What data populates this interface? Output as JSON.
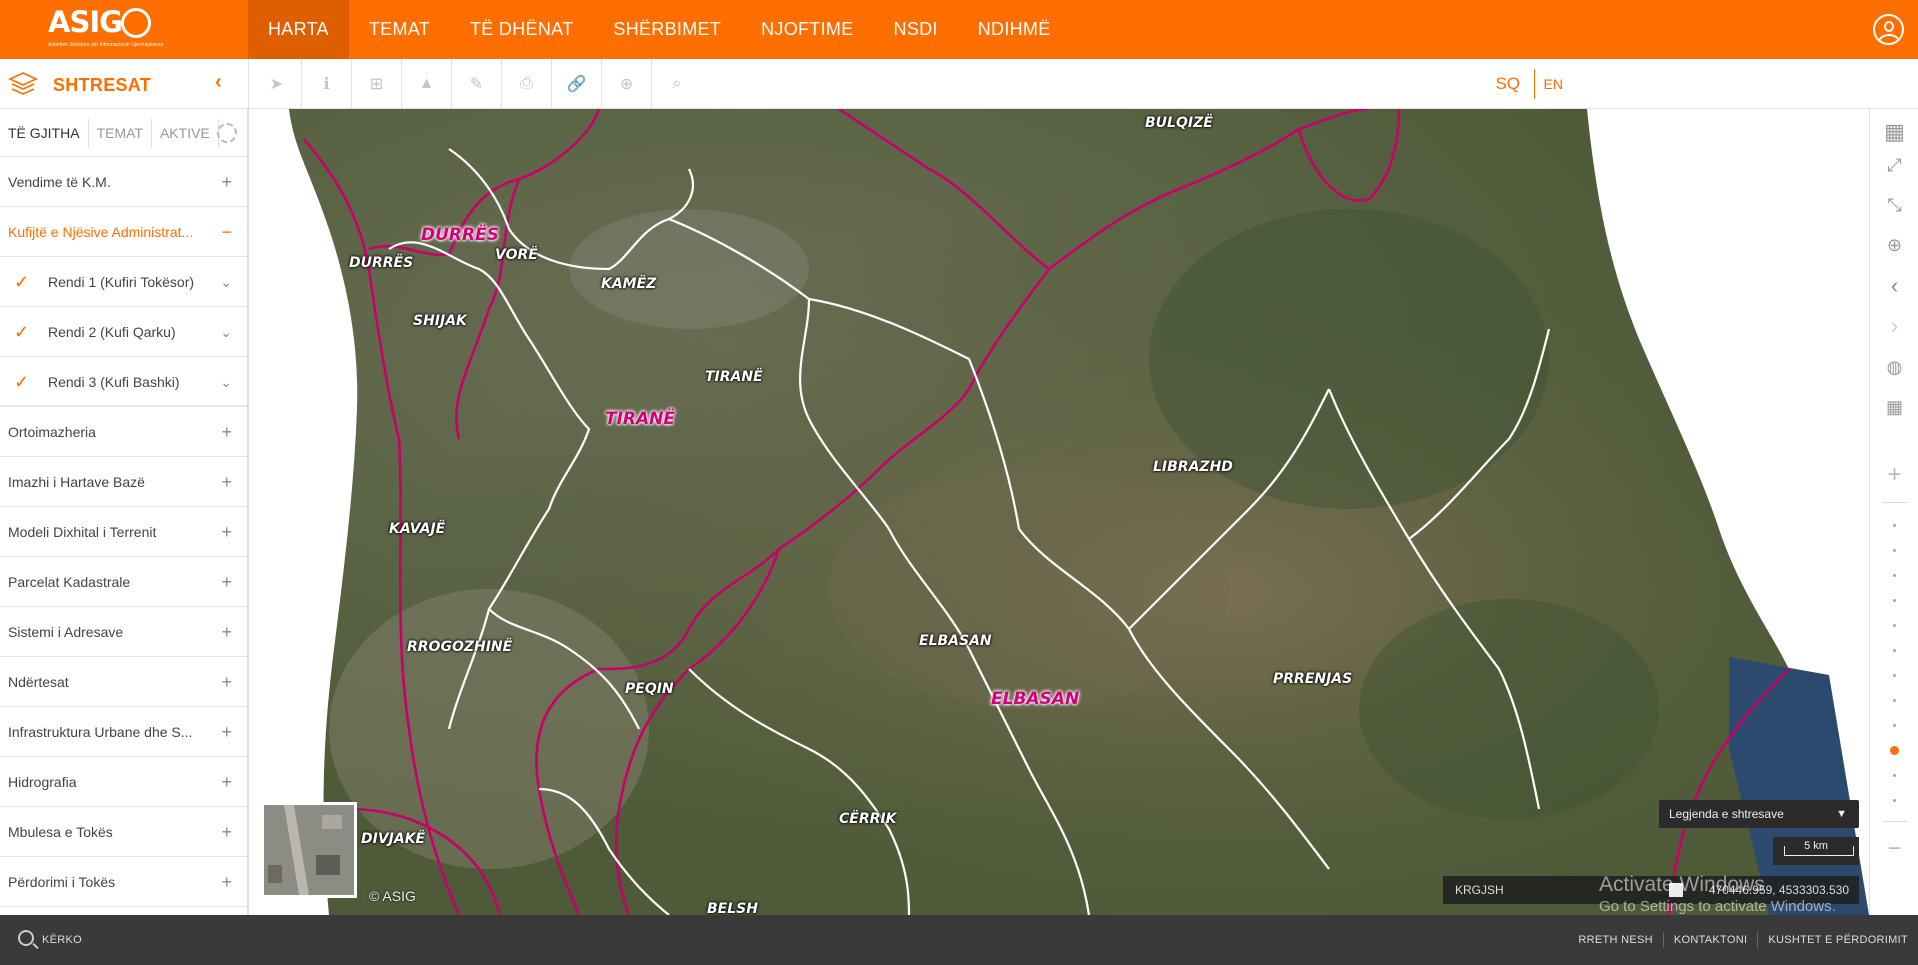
{
  "logo": {
    "text": "ASIG",
    "subtitle": "Autoriteti Shtetëror për Informacionin Gjeohapësinor"
  },
  "nav": {
    "items": [
      "HARTA",
      "TEMAT",
      "TË DHËNAT",
      "SHËRBIMET",
      "NJOFTIME",
      "NSDI",
      "NDIHMË"
    ],
    "active": 0
  },
  "toolbar": {
    "layers_title": "SHTRESAT",
    "collapse_icon": "chevron-left-icon",
    "tools": [
      "select-icon",
      "info-icon",
      "add-icon",
      "profile-icon",
      "edit-icon",
      "print-icon",
      "link-icon",
      "plus-circle-icon",
      "search-icon"
    ],
    "lang_sq": "SQ",
    "lang_en": "EN"
  },
  "sidebar": {
    "tabs": [
      "TË GJITHA",
      "TEMAT",
      "AKTIVE"
    ],
    "items": [
      {
        "label": "Vendime të K.M.",
        "sign": "+"
      },
      {
        "label": "Kufijtë e Njësive Administrat...",
        "sign": "−"
      },
      {
        "label": "Rendi 1 (Kufiri Tokësor)",
        "sub": true
      },
      {
        "label": "Rendi 2 (Kufi Qarku)",
        "sub": true
      },
      {
        "label": "Rendi 3 (Kufi Bashki)",
        "sub": true
      },
      {
        "label": "Ortoimazheria",
        "sign": "+"
      },
      {
        "label": "Imazhi i Hartave Bazë",
        "sign": "+"
      },
      {
        "label": "Modeli Dixhital i Terrenit",
        "sign": "+"
      },
      {
        "label": "Parcelat Kadastrale",
        "sign": "+"
      },
      {
        "label": "Sistemi i Adresave",
        "sign": "+"
      },
      {
        "label": "Ndërtesat",
        "sign": "+"
      },
      {
        "label": "Infrastruktura Urbane dhe S...",
        "sign": "+"
      },
      {
        "label": "Hidrografia",
        "sign": "+"
      },
      {
        "label": "Mbulesa e Tokës",
        "sign": "+"
      },
      {
        "label": "Përdorimi i Tokës",
        "sign": "+"
      }
    ]
  },
  "map": {
    "labels": [
      {
        "text": "DURRËS",
        "major": true
      },
      {
        "text": "DURRËS"
      },
      {
        "text": "VORË"
      },
      {
        "text": "KAMËZ"
      },
      {
        "text": "SHIJAK"
      },
      {
        "text": "BULQIZË"
      },
      {
        "text": "TIRANË"
      },
      {
        "text": "TIRANË",
        "major": true
      },
      {
        "text": "LIBRAZHD"
      },
      {
        "text": "KAVAJË"
      },
      {
        "text": "RROGOZHINË"
      },
      {
        "text": "PEQIN"
      },
      {
        "text": "ELBASAN"
      },
      {
        "text": "ELBASAN",
        "major": true
      },
      {
        "text": "PRRENJAS"
      },
      {
        "text": "CËRRIK"
      },
      {
        "text": "DIVJAKË"
      },
      {
        "text": "BELSH"
      }
    ],
    "copyright": "© ASIG",
    "legend_button": "Legjenda e shtresave",
    "scale": "5 km",
    "crs": "KRGJSH",
    "coordinates": "470446.959, 4533303.530",
    "watermark_title": "Activate Windows",
    "watermark_sub": "Go to Settings to activate Windows."
  },
  "rightbar": {
    "icons": [
      "basemap-icon",
      "fullscreen-icon",
      "zoom-extent-icon",
      "zoom-in-area-icon",
      "previous-extent-icon",
      "next-extent-icon",
      "globe-icon",
      "grid-icon"
    ],
    "zoom_in": "+",
    "zoom_out": "−",
    "zoom_level": 9,
    "zoom_levels": 12
  },
  "footer": {
    "search": "KËRKO",
    "links": [
      "RRETH NESH",
      "KONTAKTONI",
      "KUSHTET E PËRDORIMIT"
    ]
  }
}
